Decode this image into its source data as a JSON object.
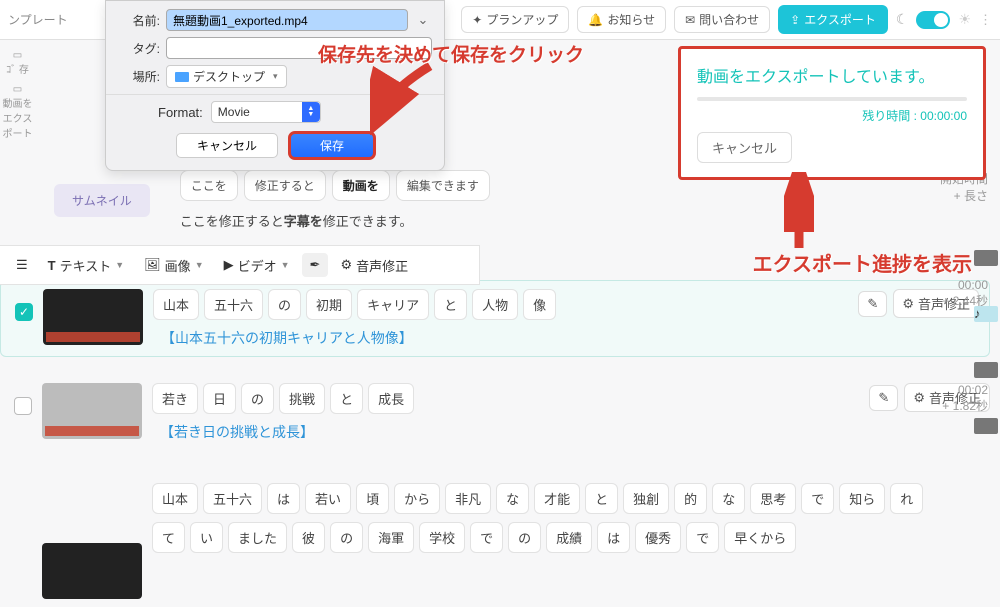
{
  "topbar": {
    "template_label": "ンプレート",
    "plan_up": "プランアップ",
    "notice": "お知らせ",
    "contact": "問い合わせ",
    "export": "エクスポート"
  },
  "sidebar": {
    "item0": "ｺﾞ\n存",
    "item1": "動画を\nエクスポート"
  },
  "dialog": {
    "name_label": "名前:",
    "name_value": "無題動画1_exported.mp4",
    "tag_label": "タグ:",
    "loc_label": "場所:",
    "loc_value": "デスクトップ",
    "format_label": "Format:",
    "format_value": "Movie",
    "cancel": "キャンセル",
    "save": "保存"
  },
  "header_chips": {
    "thumb": "サムネイル",
    "c0": "ここを",
    "c1": "修正すると",
    "c2": "動画を",
    "c3": "編集できます",
    "subtitle_pre": "ここを修正すると",
    "subtitle_bold": "字幕を",
    "subtitle_post": "修正できます。"
  },
  "toolbar": {
    "text": "テキスト",
    "image": "画像",
    "video": "ビデオ",
    "audio_fix": "音声修正"
  },
  "clips": {
    "audio_fix": "音声修正",
    "r1_tokens": [
      "山本",
      "五十六",
      "の",
      "初期",
      "キャリア",
      "と",
      "人物",
      "像"
    ],
    "r1_caption": "【山本五十六の初期キャリアと人物像】",
    "r2_tokens": [
      "若き",
      "日",
      "の",
      "挑戦",
      "と",
      "成長"
    ],
    "r2_caption": "【若き日の挑戦と成長】",
    "r3_tokens_line1": [
      "山本",
      "五十六",
      "は",
      "若い",
      "頃",
      "から",
      "非凡",
      "な",
      "才能",
      "と",
      "独創",
      "的",
      "な",
      "思考",
      "で",
      "知ら",
      "れ"
    ],
    "r3_tokens_line2": [
      "て",
      "い",
      "ました",
      "彼",
      "の",
      "海軍",
      "学校",
      "で",
      "の",
      "成績",
      "は",
      "優秀",
      "で",
      "早くから"
    ]
  },
  "timing": {
    "head_start": "開始時間",
    "head_len": "+ 長さ",
    "t1": "00:00",
    "d1": "+ 2.44秒",
    "t2": "00:02",
    "d2": "+ 1.82秒"
  },
  "export_panel": {
    "title": "動画をエクスポートしています。",
    "remaining_label": "残り時間 : ",
    "remaining_value": "00:00:00",
    "cancel": "キャンセル"
  },
  "annotations": {
    "a1": "保存先を決めて保存をクリック",
    "a2": "エクスポート進捗を表示"
  }
}
